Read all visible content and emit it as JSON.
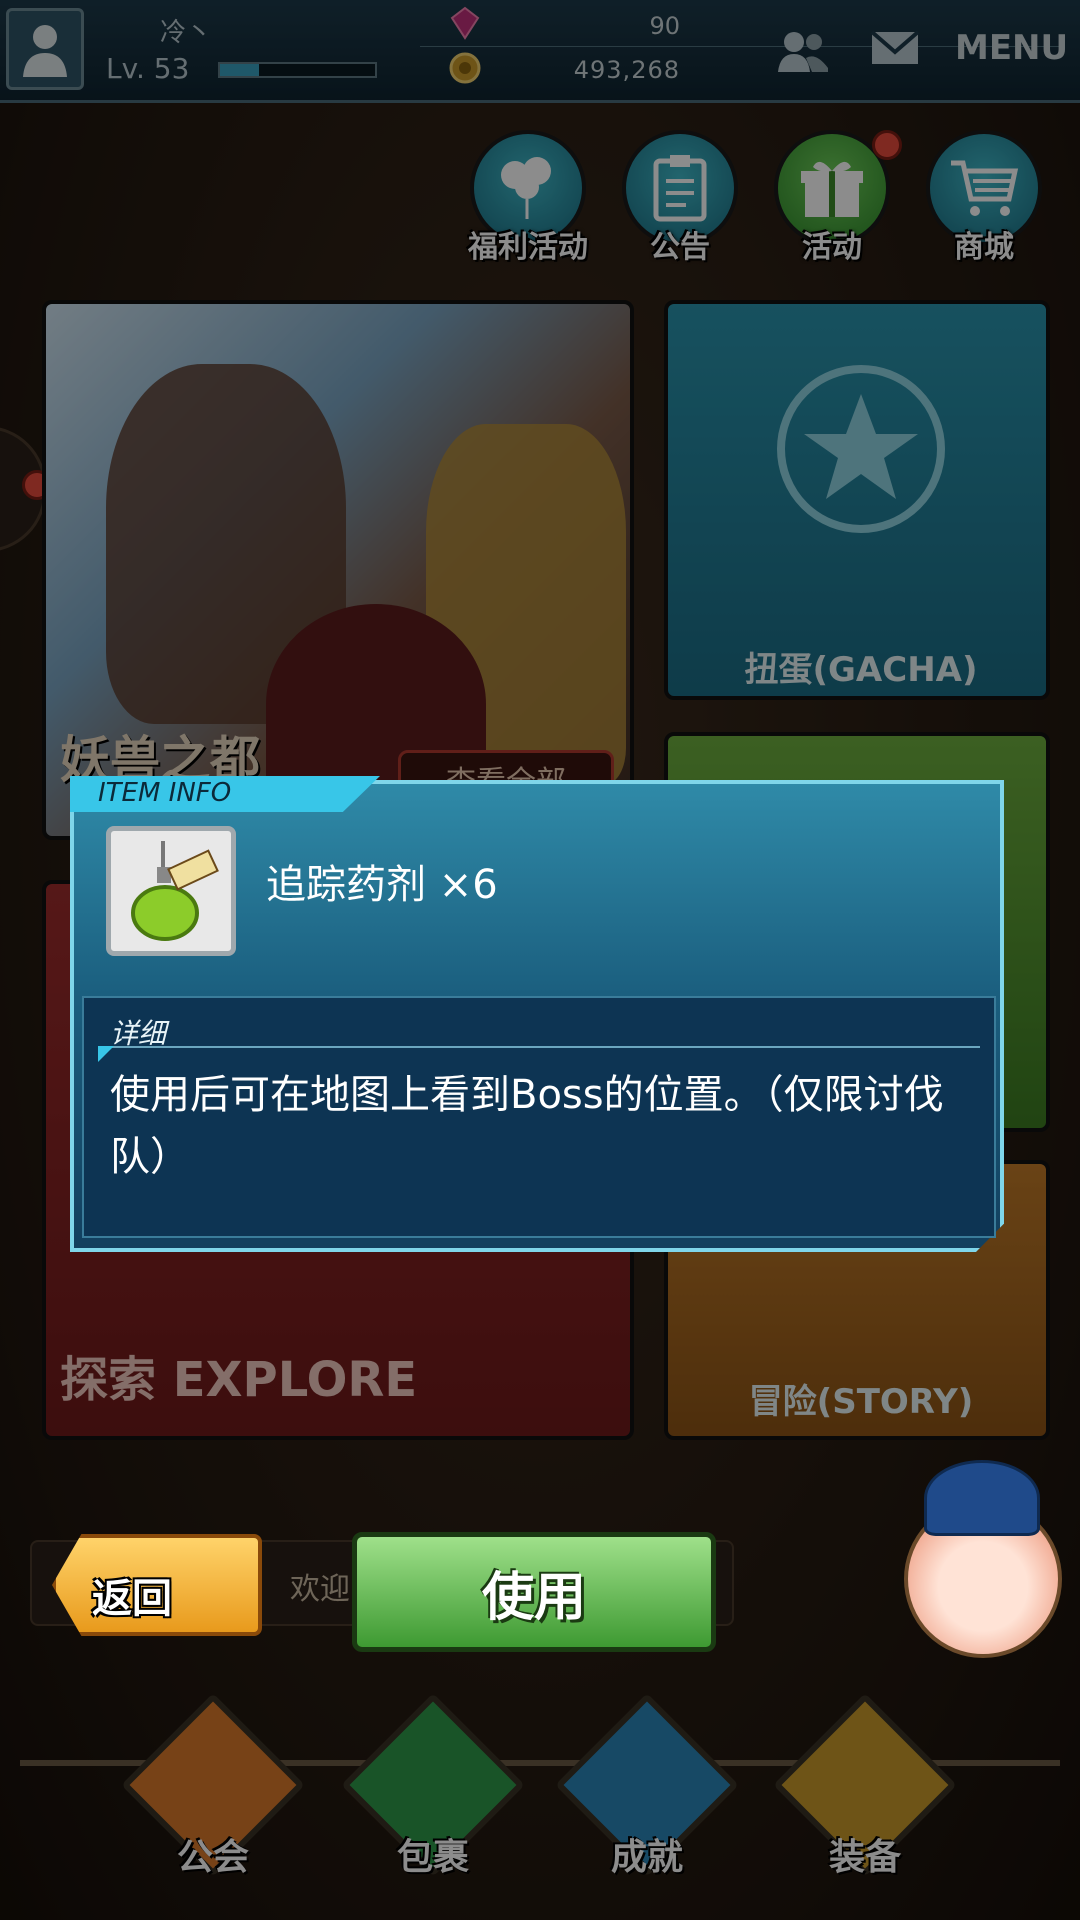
{
  "player": {
    "name": "冷丶",
    "level": "Lv. 53",
    "exp_fraction": 0.25
  },
  "resources": {
    "gems": "90",
    "gold": "493,268"
  },
  "header": {
    "menu_label": "MENU"
  },
  "shortcuts": [
    {
      "label": "福利活动",
      "icon": "balloons-icon"
    },
    {
      "label": "公告",
      "icon": "clipboard-icon"
    },
    {
      "label": "活动",
      "icon": "gift-icon",
      "badge": true
    },
    {
      "label": "商城",
      "icon": "cart-icon"
    }
  ],
  "panels": {
    "banner_title": "妖兽之都",
    "view_all": "查看全部",
    "gacha": "扭蛋(GACHA)",
    "explore": "探索 EXPLORE",
    "story": "冒险(STORY)"
  },
  "chat": {
    "text": "欢迎"
  },
  "actions": {
    "back": "返回",
    "use": "使用"
  },
  "bottom_nav": [
    {
      "label": "公会",
      "color": "#d9782a"
    },
    {
      "label": "包裹",
      "color": "#2f9a4a"
    },
    {
      "label": "成就",
      "color": "#2a86b8"
    },
    {
      "label": "装备",
      "color": "#c89a2a"
    }
  ],
  "item_info": {
    "tab_title": "ITEM INFO",
    "item_name": "追踪药剂 ×6",
    "detail_title": "详细",
    "detail_text": "使用后可在地图上看到Boss的位置。（仅限讨伐队）"
  }
}
